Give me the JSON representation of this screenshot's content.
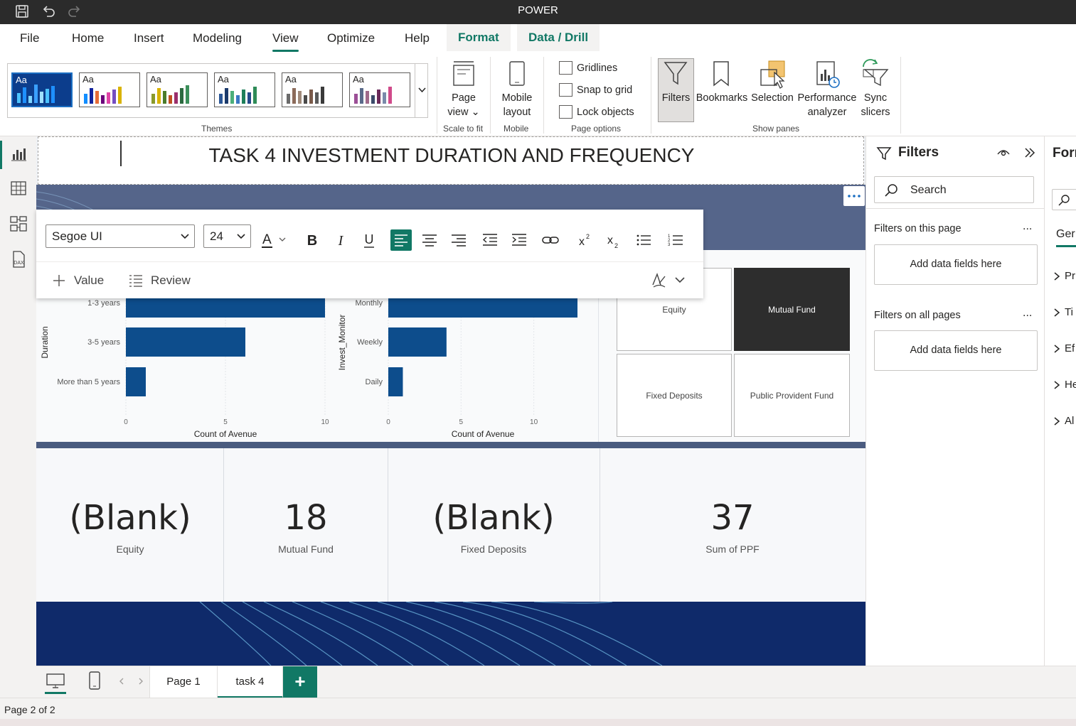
{
  "window": {
    "title": "POWER"
  },
  "ribbon_tabs": [
    "File",
    "Home",
    "Insert",
    "Modeling",
    "View",
    "Optimize",
    "Help",
    "Format",
    "Data / Drill"
  ],
  "ribbon": {
    "themes_group_label": "Themes",
    "theme_swatch_label": "Aa",
    "page_view": {
      "line1": "Page",
      "line2": "view ⌄",
      "group_label": "Scale to fit"
    },
    "mobile_layout": {
      "line1": "Mobile",
      "line2": "layout",
      "group_label": "Mobile"
    },
    "page_options": {
      "gridlines": "Gridlines",
      "snap_to_grid": "Snap to grid",
      "lock_objects": "Lock objects",
      "group_label": "Page options"
    },
    "show_panes": {
      "filters": "Filters",
      "bookmarks": "Bookmarks",
      "selection": "Selection",
      "performance_line1": "Performance",
      "performance_line2": "analyzer",
      "sync_line1": "Sync",
      "sync_line2": "slicers",
      "group_label": "Show panes"
    }
  },
  "report": {
    "title": "TASK 4  INVESTMENT DURATION AND FREQUENCY"
  },
  "text_toolbar": {
    "font_family": "Segoe UI",
    "font_size": "24",
    "value_label": "Value",
    "review_label": "Review"
  },
  "chart_data": [
    {
      "type": "bar",
      "orientation": "horizontal",
      "categories": [
        "1-3 years",
        "3-5 years",
        "More than 5 years"
      ],
      "values": [
        10,
        6,
        1
      ],
      "xlabel": "Count of Avenue",
      "ylabel": "Duration",
      "xticks": [
        "0",
        "5",
        "10"
      ],
      "xlim": [
        0,
        10
      ]
    },
    {
      "type": "bar",
      "orientation": "horizontal",
      "categories": [
        "Monthly",
        "Weekly",
        "Daily"
      ],
      "values": [
        13,
        4,
        1
      ],
      "xlabel": "Count of Avenue",
      "ylabel": "Invest_Monitor",
      "xticks": [
        "0",
        "5",
        "10"
      ],
      "xlim": [
        0,
        13
      ]
    }
  ],
  "slicer_tiles": [
    {
      "label": "Equity",
      "selected": false
    },
    {
      "label": "Mutual Fund",
      "selected": true
    },
    {
      "label": "Fixed Deposits",
      "selected": false
    },
    {
      "label": "Public Provident Fund",
      "selected": false
    }
  ],
  "cards": [
    {
      "value": "(Blank)",
      "label": "Equity"
    },
    {
      "value": "18",
      "label": "Mutual Fund"
    },
    {
      "value": "(Blank)",
      "label": "Fixed Deposits"
    },
    {
      "value": "37",
      "label": "Sum of PPF"
    }
  ],
  "filters_pane": {
    "title": "Filters",
    "search_placeholder": "Search",
    "on_this_page": "Filters on this page",
    "on_all_pages": "Filters on all pages",
    "add_fields": "Add data fields here",
    "more": "..."
  },
  "format_pane": {
    "title": "Forr",
    "tab": "Ger",
    "sections": [
      "Pr",
      "Ti",
      "Ef",
      "He",
      "Al"
    ]
  },
  "page_tabs": [
    "Page 1",
    "task 4"
  ],
  "add_page": "+",
  "status": {
    "page_indicator": "Page 2 of 2"
  },
  "colors": {
    "accent": "#117865",
    "bar": "#0d4d8c",
    "header_band": "#55658a",
    "footer_band": "#0f2a6a"
  }
}
